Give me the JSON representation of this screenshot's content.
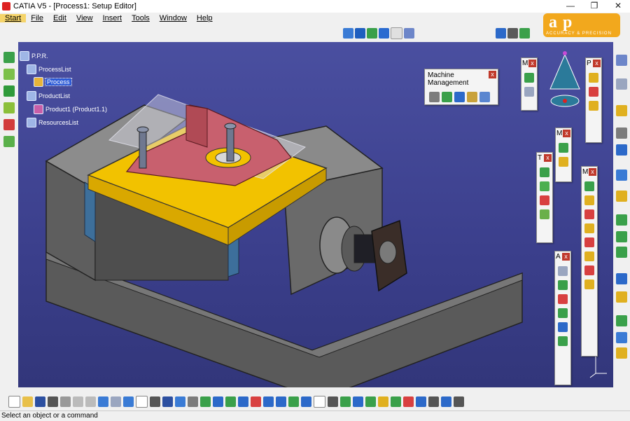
{
  "window": {
    "title": "CATIA V5 - [Process1: Setup Editor]",
    "minimize": "—",
    "restore": "❐",
    "close": "✕"
  },
  "menu": [
    "Start",
    "File",
    "Edit",
    "View",
    "Insert",
    "Tools",
    "Window",
    "Help"
  ],
  "logo": {
    "text": "ap",
    "tagline": "ACCURACY & PRECISION"
  },
  "tree": {
    "root": "P.P.R.",
    "process_list": "ProcessList",
    "process": "Process",
    "product_list": "ProductList",
    "product": "Product1 (Product1.1)",
    "resources_list": "ResourcesList"
  },
  "machine_panel": {
    "title": "Machine Management",
    "close": "x"
  },
  "mini_panels": [
    {
      "id": "panel-m1",
      "title": "M",
      "close": "x"
    },
    {
      "id": "panel-p",
      "title": "P",
      "close": "x"
    },
    {
      "id": "panel-m2",
      "title": "M",
      "close": "x"
    },
    {
      "id": "panel-t",
      "title": "T",
      "close": "x"
    },
    {
      "id": "panel-m3",
      "title": "M",
      "close": "x"
    },
    {
      "id": "panel-a",
      "title": "A",
      "close": "x"
    }
  ],
  "status": {
    "prompt": "Select an object or a command"
  },
  "colors": {
    "viewport": "#4a4fa0",
    "vise_body": "#6e6e6e",
    "plate": "#f2c200",
    "part": "#c0606a",
    "accent": "#f2a81d"
  }
}
